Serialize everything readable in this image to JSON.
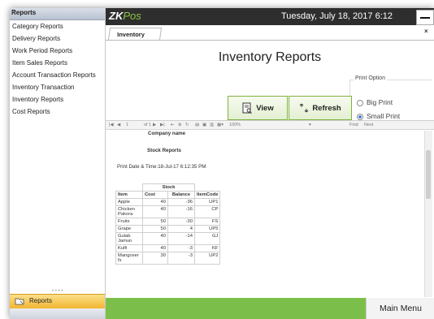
{
  "sidebar": {
    "header": "Reports",
    "collapse_glyph": "«",
    "items": [
      {
        "label": "Category Reports"
      },
      {
        "label": "Delivery Reports"
      },
      {
        "label": "Work Period Reports"
      },
      {
        "label": "Item Sales Reports"
      },
      {
        "label": "Account Transaction Reports"
      },
      {
        "label": "Inventory Transaction"
      },
      {
        "label": "Inventory Reports"
      },
      {
        "label": "Cost Reports"
      }
    ],
    "bottom_button": {
      "label": "Reports",
      "icon": "reports-folder-icon"
    }
  },
  "topbar": {
    "logo_zk": "ZK",
    "logo_pos": "Pos",
    "datetime": "Tuesday, July 18, 2017 6:12"
  },
  "tab": {
    "label": "Inventory",
    "close_glyph": "×"
  },
  "page": {
    "title": "Inventory Reports"
  },
  "print_option": {
    "label": "Print Option",
    "options": [
      {
        "label": "Big Print",
        "selected": false
      },
      {
        "label": "Small Print",
        "selected": true
      }
    ]
  },
  "buttons": {
    "view": "View",
    "refresh": "Refresh"
  },
  "viewer_toolbar": {
    "page": "1",
    "of_pages": "of 1",
    "zoom": "100%",
    "find": "Find",
    "next": "Next"
  },
  "report": {
    "company": "Company name",
    "title": "Stock Reports",
    "print_datetime": "Print Date & Time:18-Jul-17 6:12:35 PM",
    "group_header": "Stock",
    "columns": [
      "Item",
      "Cost",
      "Balance",
      "ItemCode"
    ],
    "rows": [
      {
        "item": "Apple",
        "cost": "40",
        "balance": "-36",
        "code": "UP1"
      },
      {
        "item": "Chicken Pakora",
        "cost": "40",
        "balance": "-16",
        "code": "CP"
      },
      {
        "item": "Fruits",
        "cost": "50",
        "balance": "-30",
        "code": "FS"
      },
      {
        "item": "Grape",
        "cost": "50",
        "balance": "4",
        "code": "UP5"
      },
      {
        "item": "Gulab Jamun",
        "cost": "40",
        "balance": "-14",
        "code": "GJ"
      },
      {
        "item": "Kulfi",
        "cost": "40",
        "balance": "-3",
        "code": "KF"
      },
      {
        "item": "Mangoser fs",
        "cost": "30",
        "balance": "-3",
        "code": "UP2"
      }
    ]
  },
  "bottombar": {
    "main_menu": "Main Menu"
  },
  "colors": {
    "accent_green": "#7bbf4a",
    "topbar": "#2e2e2e",
    "reports_button": "#f2b32c"
  }
}
